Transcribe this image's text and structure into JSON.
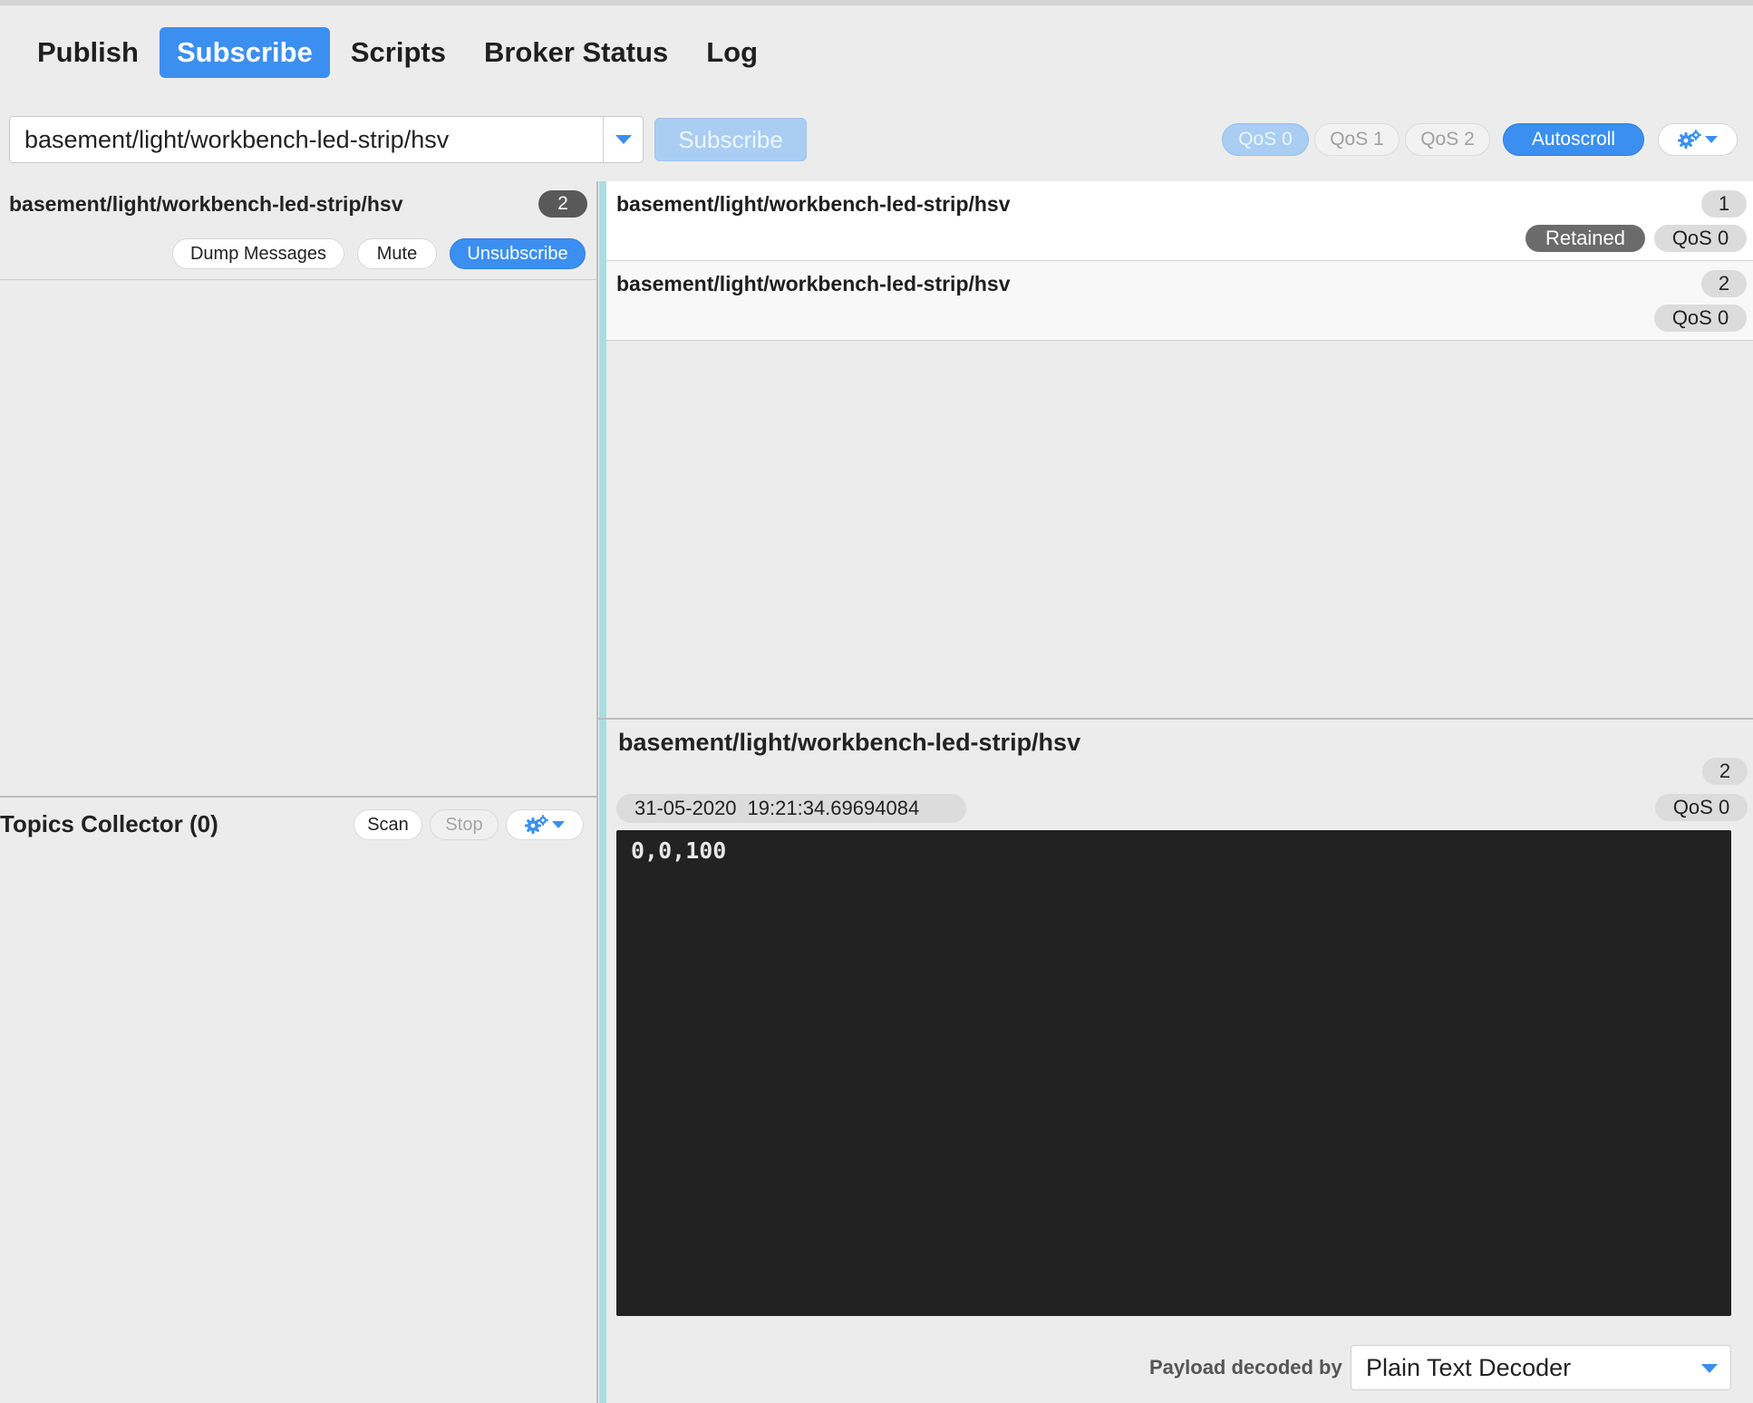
{
  "tabs": [
    {
      "label": "Publish",
      "active": false
    },
    {
      "label": "Subscribe",
      "active": true
    },
    {
      "label": "Scripts",
      "active": false
    },
    {
      "label": "Broker Status",
      "active": false
    },
    {
      "label": "Log",
      "active": false
    }
  ],
  "subscribe_bar": {
    "topic_value": "basement/light/workbench-led-strip/hsv",
    "subscribe_label": "Subscribe",
    "qos0": "QoS 0",
    "qos1": "QoS 1",
    "qos2": "QoS 2",
    "autoscroll": "Autoscroll",
    "selected_qos": "QoS 0"
  },
  "subscription": {
    "topic": "basement/light/workbench-led-strip/hsv",
    "count": "2",
    "dump_label": "Dump Messages",
    "mute_label": "Mute",
    "unsubscribe_label": "Unsubscribe"
  },
  "collector": {
    "title": "Topics Collector (0)",
    "scan_label": "Scan",
    "stop_label": "Stop"
  },
  "messages": [
    {
      "topic": "basement/light/workbench-led-strip/hsv",
      "number": "1",
      "retained": "Retained",
      "qos": "QoS 0"
    },
    {
      "topic": "basement/light/workbench-led-strip/hsv",
      "number": "2",
      "qos": "QoS 0"
    }
  ],
  "detail": {
    "topic": "basement/light/workbench-led-strip/hsv",
    "number": "2",
    "date": "31-05-2020",
    "time": "19:21:34.69694084",
    "qos": "QoS 0",
    "payload": "0,0,100",
    "decoder_label": "Payload decoded by",
    "decoder_value": "Plain Text Decoder"
  },
  "colors": {
    "accent": "#3b8ff0",
    "accent_disabled": "#a9cdf3",
    "splitter_accent": "#a9dde1",
    "payload_bg": "#222222",
    "retained_bg": "#6b6b6b"
  },
  "icons": [
    "chevron-down-icon",
    "gear-icon"
  ]
}
